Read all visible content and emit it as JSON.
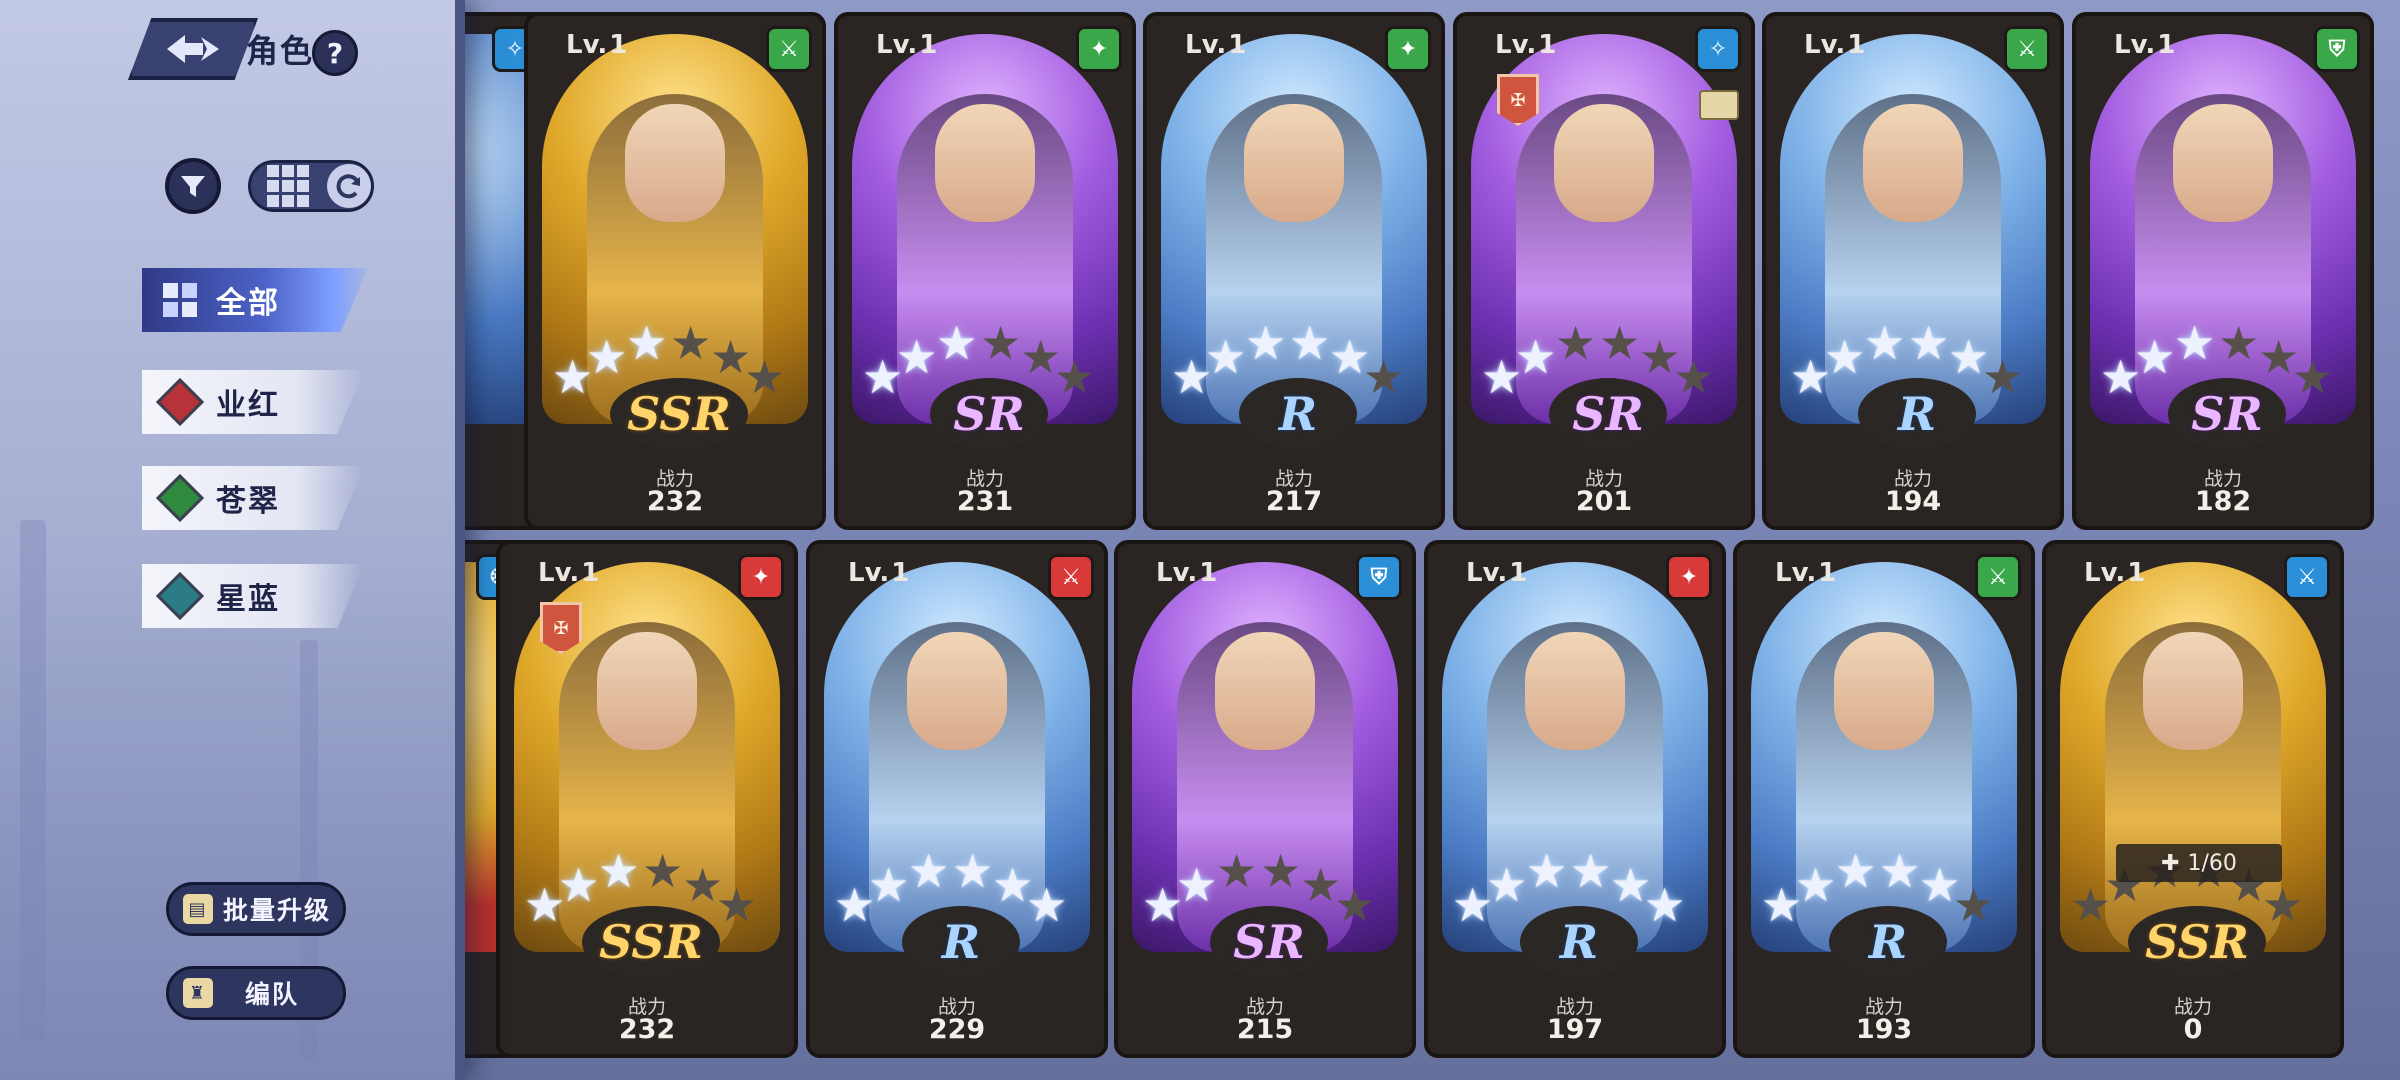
{
  "header": {
    "title": "角色",
    "help_label": "?"
  },
  "toolbar": {
    "filter_icon": "filter-icon",
    "view_icon": "grid-icon",
    "refresh_icon": "refresh-icon"
  },
  "categories": [
    {
      "label": "全部",
      "gem_color": "#6f8ef0",
      "active": true
    },
    {
      "label": "业红",
      "gem_color": "#b8323a",
      "active": false
    },
    {
      "label": "苍翠",
      "gem_color": "#2e8a3c",
      "active": false
    },
    {
      "label": "星蓝",
      "gem_color": "#2c7c86",
      "active": false
    }
  ],
  "actions": {
    "batch_upgrade": "批量升级",
    "team": "编队"
  },
  "power_label": "战力",
  "lv_prefix": "Lv.",
  "cards_row1": [
    {
      "level": "1",
      "rarity": "SSR",
      "theme": "gold",
      "power": "232",
      "type_color": "#3aa84a",
      "type_glyph": "⚔",
      "stars": 3,
      "max_stars": 6
    },
    {
      "level": "1",
      "rarity": "SR",
      "theme": "purple",
      "power": "231",
      "type_color": "#3aa84a",
      "type_glyph": "✦",
      "stars": 3,
      "max_stars": 6
    },
    {
      "level": "1",
      "rarity": "R",
      "theme": "blue",
      "power": "217",
      "type_color": "#3aa84a",
      "type_glyph": "✦",
      "stars": 5,
      "max_stars": 6
    },
    {
      "level": "1",
      "rarity": "SR",
      "theme": "purple",
      "power": "201",
      "type_color": "#2a8fd6",
      "type_glyph": "✧",
      "stars": 2,
      "max_stars": 6,
      "faction": true,
      "ticket": true
    },
    {
      "level": "1",
      "rarity": "R",
      "theme": "blue",
      "power": "194",
      "type_color": "#3aa84a",
      "type_glyph": "⚔",
      "stars": 5,
      "max_stars": 6
    },
    {
      "level": "1",
      "rarity": "SR",
      "theme": "purple",
      "power": "182",
      "type_color": "#3aa84a",
      "type_glyph": "⛨",
      "stars": 3,
      "max_stars": 6
    }
  ],
  "cards_row2": [
    {
      "level": "1",
      "rarity": "SSR",
      "theme": "gold",
      "power": "232",
      "type_color": "#d83a3a",
      "type_glyph": "✦",
      "stars": 3,
      "max_stars": 6,
      "faction": true
    },
    {
      "level": "1",
      "rarity": "R",
      "theme": "blue",
      "power": "229",
      "type_color": "#d83a3a",
      "type_glyph": "⚔",
      "stars": 6,
      "max_stars": 6
    },
    {
      "level": "1",
      "rarity": "SR",
      "theme": "purple",
      "power": "215",
      "type_color": "#2a8fd6",
      "type_glyph": "⛨",
      "stars": 2,
      "max_stars": 6
    },
    {
      "level": "1",
      "rarity": "R",
      "theme": "blue",
      "power": "197",
      "type_color": "#d83a3a",
      "type_glyph": "✦",
      "stars": 6,
      "max_stars": 6
    },
    {
      "level": "1",
      "rarity": "R",
      "theme": "blue",
      "power": "193",
      "type_color": "#3aa84a",
      "type_glyph": "⚔",
      "stars": 5,
      "max_stars": 6
    },
    {
      "level": "1",
      "rarity": "SSR",
      "theme": "gold",
      "power": "0",
      "type_color": "#2a8fd6",
      "type_glyph": "⚔",
      "stars": 0,
      "max_stars": 6,
      "shard": "1/60"
    }
  ]
}
